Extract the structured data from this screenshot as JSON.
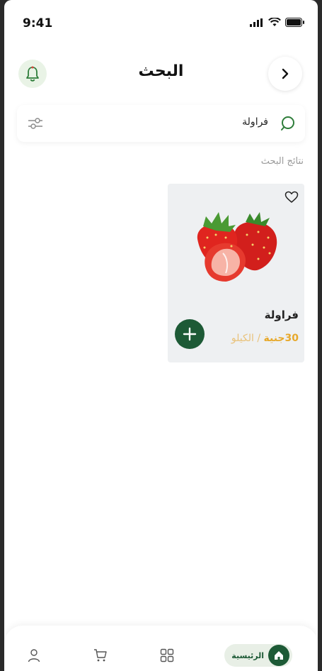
{
  "status_bar": {
    "time": "9:41"
  },
  "header": {
    "title": "البحث"
  },
  "search": {
    "query": "فراولة"
  },
  "results": {
    "label": "نتائج البحث",
    "items": [
      {
        "name": "فراولة",
        "price": "30جنية",
        "unit": " / الكيلو"
      }
    ]
  },
  "bottom_nav": {
    "home_label": "الرئيسية"
  },
  "colors": {
    "brand_green": "#1d5a36",
    "price_orange": "#e7a92c",
    "card_bg": "#eef0f2"
  }
}
